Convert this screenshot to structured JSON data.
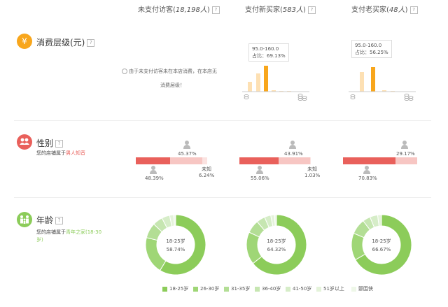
{
  "columns": [
    {
      "label": "未支付访客",
      "count": "18,198人",
      "help": "?"
    },
    {
      "label": "支付新买家",
      "count": "583人",
      "help": "?"
    },
    {
      "label": "支付老买家",
      "count": "48人",
      "help": "?"
    }
  ],
  "consumption": {
    "icon_char": "¥",
    "title": "消费层级(元)",
    "no_data_line1": "由于未支付访客未在本店消费，在本店无",
    "no_data_line2": "消费层级！",
    "new_tip_range": "95.0-160.0",
    "new_tip_share": "占比：69.13%",
    "old_tip_range": "95.0-160.0",
    "old_tip_share": "占比：56.25%"
  },
  "gender": {
    "title": "性别",
    "desc_prefix": "您的店铺属于",
    "desc_highlight": "男人知音",
    "unknown_label": "未知",
    "unpaid": {
      "female": "45.37%",
      "male": "48.39%",
      "unknown": "6.24%",
      "female_share": 0.4537,
      "male_share": 0.4839,
      "unknown_share": 0.0624
    },
    "new": {
      "female": "43.91%",
      "male": "55.06%",
      "unknown": "1.03%",
      "female_share": 0.4391,
      "male_share": 0.5506,
      "unknown_share": 0.0103
    },
    "old": {
      "female": "29.17%",
      "male": "70.83%",
      "female_share": 0.2917,
      "male_share": 0.7083
    }
  },
  "age": {
    "title": "年龄",
    "desc_prefix": "您的店铺属于",
    "desc_highlight": "青年之家(18-30岁)",
    "donuts": [
      {
        "center_label": "18-25岁",
        "center_value": "58.74%",
        "slices": [
          58.74,
          20.1,
          8.2,
          5.4,
          4.3,
          2.2,
          1.06
        ]
      },
      {
        "center_label": "18-25岁",
        "center_value": "64.32%",
        "slices": [
          64.32,
          17.5,
          7.1,
          4.6,
          3.4,
          2.0,
          1.08
        ]
      },
      {
        "center_label": "18-25岁",
        "center_value": "66.67%",
        "slices": [
          66.67,
          14.58,
          8.33,
          4.17,
          4.17,
          2.08,
          0.0
        ]
      }
    ],
    "legend": [
      {
        "label": "18-25岁",
        "color": "#8ccc5a"
      },
      {
        "label": "26-30岁",
        "color": "#9fd676"
      },
      {
        "label": "31-35岁",
        "color": "#b3de95"
      },
      {
        "label": "36-40岁",
        "color": "#c6e6b1"
      },
      {
        "label": "41-50岁",
        "color": "#d6edc8"
      },
      {
        "label": "51岁以上",
        "color": "#e4f3da"
      },
      {
        "label": "颤围侠",
        "color": "#eef7e8"
      }
    ]
  },
  "colors": {
    "consumption_badge": "#f8a61c",
    "gender_badge": "#e9605b",
    "age_badge": "#8ccc5a",
    "male_bar": "#e9605b",
    "female_bar": "#f7c6c3",
    "highlight_bar": "#f8a61c",
    "normal_bar": "#fde0b3"
  }
}
